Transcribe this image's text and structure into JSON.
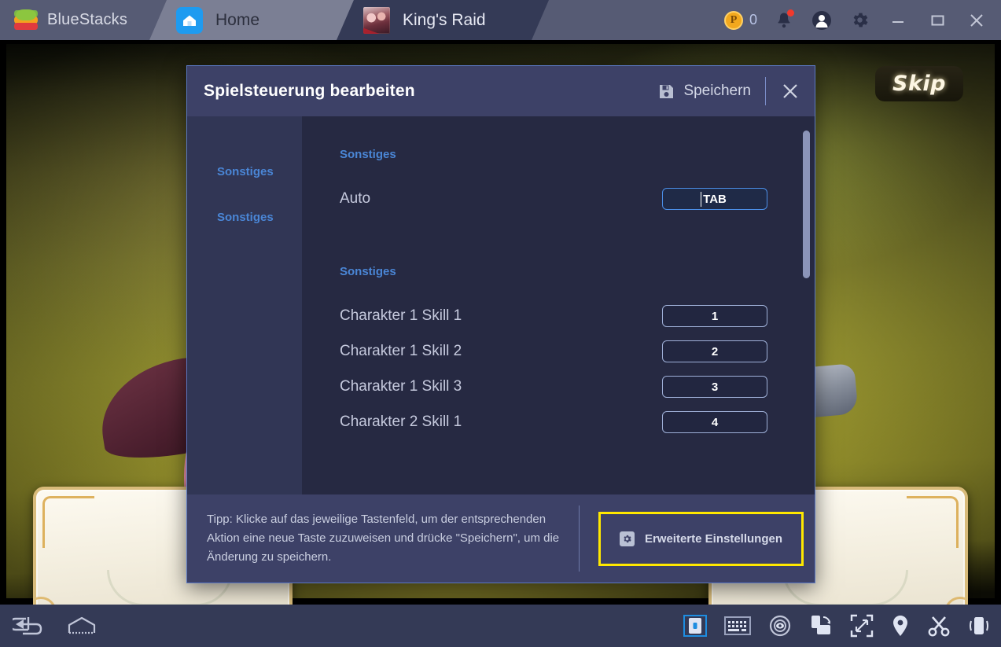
{
  "titlebar": {
    "brand": "BlueStacks",
    "brand_logo_icon": "bluestacks-logo-icon",
    "tabs": [
      {
        "label": "Home",
        "icon": "home-icon",
        "active": false
      },
      {
        "label": "King's Raid",
        "icon": "game-thumbnail-icon",
        "active": true
      }
    ],
    "points": {
      "icon": "points-coin-icon",
      "value": "0"
    },
    "notifications_icon": "bell-icon",
    "notifications_badge": true,
    "account_icon": "user-avatar-icon",
    "settings_icon": "gear-icon",
    "window_controls": {
      "minimize_icon": "minimize-icon",
      "maximize_icon": "maximize-icon",
      "close_icon": "close-icon"
    }
  },
  "game": {
    "skip_button": "Skip"
  },
  "modal": {
    "title": "Spielsteuerung bearbeiten",
    "save_label": "Speichern",
    "save_icon": "floppy-disk-save-icon",
    "close_icon": "close-icon",
    "sidebar": [
      {
        "label": "Sonstiges"
      },
      {
        "label": "Sonstiges"
      }
    ],
    "groups": [
      {
        "title": "Sonstiges",
        "rows": [
          {
            "label": "Auto",
            "key": "TAB",
            "focused": true
          }
        ]
      },
      {
        "title": "Sonstiges",
        "rows": [
          {
            "label": "Charakter 1 Skill 1",
            "key": "1",
            "focused": false
          },
          {
            "label": "Charakter 1 Skill 2",
            "key": "2",
            "focused": false
          },
          {
            "label": "Charakter 1 Skill 3",
            "key": "3",
            "focused": false
          },
          {
            "label": "Charakter 2 Skill 1",
            "key": "4",
            "focused": false
          }
        ]
      }
    ],
    "tip": "Tipp: Klicke auf das jeweilige Tastenfeld, um der entsprechenden Aktion eine neue Taste zuzuweisen und drücke \"Speichern\", um die Änderung zu speichern.",
    "advanced_label": "Erweiterte Einstellungen",
    "advanced_icon": "gear-square-icon",
    "highlight_color": "#ffe800"
  },
  "bottombar": {
    "left": [
      {
        "icon": "back-arrow-icon",
        "name": "back-button"
      },
      {
        "icon": "home-outline-icon",
        "name": "home-button"
      }
    ],
    "right": [
      {
        "icon": "game-controls-icon",
        "name": "game-controls-button",
        "active": true
      },
      {
        "icon": "keyboard-icon",
        "name": "keyboard-button",
        "active": false
      },
      {
        "icon": "eye-icon",
        "name": "eye-button",
        "active": false
      },
      {
        "icon": "rotate-screen-icon",
        "name": "rotate-screen-button",
        "active": false
      },
      {
        "icon": "fullscreen-icon",
        "name": "fullscreen-button",
        "active": false
      },
      {
        "icon": "location-pin-icon",
        "name": "location-button",
        "active": false
      },
      {
        "icon": "scissors-icon",
        "name": "screenshot-button",
        "active": false
      },
      {
        "icon": "shake-phone-icon",
        "name": "shake-button",
        "active": false
      }
    ]
  },
  "colors": {
    "titlebar_bg": "#565b74",
    "modal_head_bg": "#3d4167",
    "modal_body_bg": "#262942",
    "accent_blue": "#4a86d6",
    "highlight_yellow": "#ffe800"
  }
}
